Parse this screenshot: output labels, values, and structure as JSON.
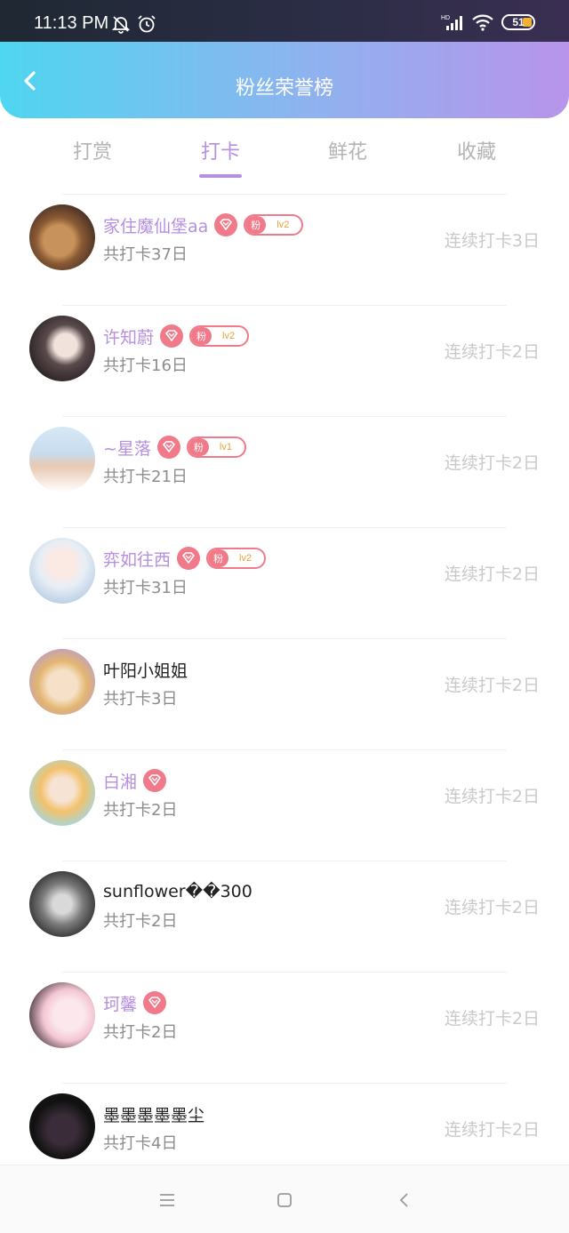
{
  "status": {
    "time": "11:13 PM",
    "battery": "51"
  },
  "header": {
    "title": "粉丝荣誉榜"
  },
  "tabs": [
    {
      "label": "打赏",
      "active": false
    },
    {
      "label": "打卡",
      "active": true
    },
    {
      "label": "鲜花",
      "active": false
    },
    {
      "label": "收藏",
      "active": false
    }
  ],
  "fan_badge_label": "粉",
  "accent_color": "#b68fe0",
  "badge_color": "#f07a8a",
  "rows": [
    {
      "name": "家住魔仙堡aa",
      "vip": true,
      "heart": true,
      "level": "lv2",
      "total": "共打卡37日",
      "streak": "连续打卡3日",
      "avatar": "avatar-photo-dog"
    },
    {
      "name": "许知蔚",
      "vip": true,
      "heart": true,
      "level": "lv2",
      "total": "共打卡16日",
      "streak": "连续打卡2日",
      "avatar": "avatar-photo-girl"
    },
    {
      "name": "~星落",
      "vip": true,
      "heart": true,
      "level": "lv1",
      "total": "共打卡21日",
      "streak": "连续打卡2日",
      "avatar": "avatar-photo-boy"
    },
    {
      "name": "弈如往西",
      "vip": true,
      "heart": true,
      "level": "lv2",
      "total": "共打卡31日",
      "streak": "连续打卡2日",
      "avatar": "avatar-anime-white"
    },
    {
      "name": "叶阳小姐姐",
      "vip": false,
      "heart": false,
      "level": "",
      "total": "共打卡3日",
      "streak": "连续打卡2日",
      "avatar": "avatar-anime-blonde"
    },
    {
      "name": "白湘",
      "vip": true,
      "heart": true,
      "level": "",
      "total": "共打卡2日",
      "streak": "连续打卡2日",
      "avatar": "avatar-anime-flowers"
    },
    {
      "name": "sunflower��300",
      "vip": false,
      "heart": false,
      "level": "",
      "total": "共打卡2日",
      "streak": "连续打卡2日",
      "avatar": "avatar-photo-bw"
    },
    {
      "name": "珂馨",
      "vip": true,
      "heart": true,
      "level": "",
      "total": "共打卡2日",
      "streak": "连续打卡2日",
      "avatar": "avatar-anime-couple"
    },
    {
      "name": "墨墨墨墨墨尘",
      "vip": false,
      "heart": false,
      "level": "",
      "total": "共打卡4日",
      "streak": "连续打卡2日",
      "avatar": "avatar-dark-cat"
    }
  ]
}
